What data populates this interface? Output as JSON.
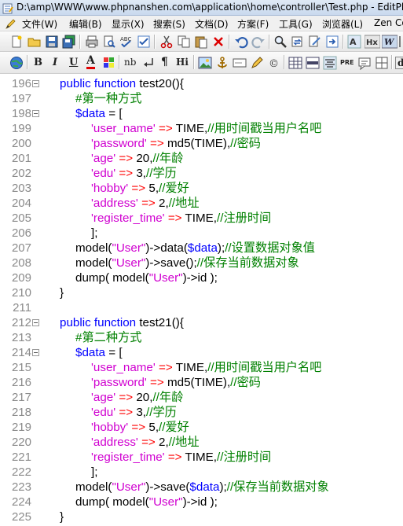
{
  "window": {
    "title": "D:\\amp\\WWW\\www.phpnanshen.com\\application\\home\\controller\\Test.php - EditPlus"
  },
  "menu": {
    "items": [
      "文件(W)",
      "编辑(B)",
      "显示(X)",
      "搜索(S)",
      "文档(D)",
      "方案(F)",
      "工具(G)",
      "浏览器(L)",
      "Zen Co"
    ]
  },
  "toolbar2": {
    "bold": "B",
    "italic": "I",
    "underline": "U",
    "font_color": "A",
    "nb": "nb",
    "para": "¶",
    "hi": "Hi",
    "pre": "PRE",
    "hx": "Hx",
    "w": "W",
    "d": "d"
  },
  "editor": {
    "lines": [
      {
        "n": "196",
        "fold": true,
        "indent": 0,
        "tokens": [
          [
            "kw",
            "public function "
          ],
          [
            "fn",
            "test20(){"
          ]
        ]
      },
      {
        "n": "197",
        "fold": false,
        "indent": 1,
        "tokens": [
          [
            "cm",
            "#第一种方式"
          ]
        ]
      },
      {
        "n": "198",
        "fold": true,
        "indent": 1,
        "tokens": [
          [
            "var",
            "$data"
          ],
          [
            "fn",
            " = ["
          ]
        ]
      },
      {
        "n": "199",
        "fold": false,
        "indent": 2,
        "tokens": [
          [
            "str",
            "'user_name'"
          ],
          [
            "op",
            " => "
          ],
          [
            "fn",
            "TIME,"
          ],
          [
            "cm",
            "//用时间戳当用户名吧"
          ]
        ]
      },
      {
        "n": "200",
        "fold": false,
        "indent": 2,
        "tokens": [
          [
            "str",
            "'password'"
          ],
          [
            "op",
            " => "
          ],
          [
            "fn",
            "md5(TIME),"
          ],
          [
            "cm",
            "//密码"
          ]
        ]
      },
      {
        "n": "201",
        "fold": false,
        "indent": 2,
        "tokens": [
          [
            "str",
            "'age'"
          ],
          [
            "op",
            " => "
          ],
          [
            "fn",
            "20,"
          ],
          [
            "cm",
            "//年龄"
          ]
        ]
      },
      {
        "n": "202",
        "fold": false,
        "indent": 2,
        "tokens": [
          [
            "str",
            "'edu'"
          ],
          [
            "op",
            " => "
          ],
          [
            "fn",
            "3,"
          ],
          [
            "cm",
            "//学历"
          ]
        ]
      },
      {
        "n": "203",
        "fold": false,
        "indent": 2,
        "tokens": [
          [
            "str",
            "'hobby'"
          ],
          [
            "op",
            " => "
          ],
          [
            "fn",
            "5,"
          ],
          [
            "cm",
            "//爱好"
          ]
        ]
      },
      {
        "n": "204",
        "fold": false,
        "indent": 2,
        "tokens": [
          [
            "str",
            "'address'"
          ],
          [
            "op",
            " => "
          ],
          [
            "fn",
            "2,"
          ],
          [
            "cm",
            "//地址"
          ]
        ]
      },
      {
        "n": "205",
        "fold": false,
        "indent": 2,
        "tokens": [
          [
            "str",
            "'register_time'"
          ],
          [
            "op",
            " => "
          ],
          [
            "fn",
            "TIME,"
          ],
          [
            "cm",
            "//注册时间"
          ]
        ]
      },
      {
        "n": "206",
        "fold": false,
        "indent": 2,
        "tokens": [
          [
            "fn",
            "];"
          ]
        ]
      },
      {
        "n": "207",
        "fold": false,
        "indent": 1,
        "tokens": [
          [
            "fn",
            "model("
          ],
          [
            "str",
            "\"User\""
          ],
          [
            "fn",
            ")->data("
          ],
          [
            "var",
            "$data"
          ],
          [
            "fn",
            ");"
          ],
          [
            "cm",
            "//设置数据对象值"
          ]
        ]
      },
      {
        "n": "208",
        "fold": false,
        "indent": 1,
        "tokens": [
          [
            "fn",
            "model("
          ],
          [
            "str",
            "\"User\""
          ],
          [
            "fn",
            ")->save();"
          ],
          [
            "cm",
            "//保存当前数据对象"
          ]
        ]
      },
      {
        "n": "209",
        "fold": false,
        "indent": 1,
        "tokens": [
          [
            "fn",
            "dump( model("
          ],
          [
            "str",
            "\"User\""
          ],
          [
            "fn",
            ")->id );"
          ]
        ]
      },
      {
        "n": "210",
        "fold": false,
        "indent": 0,
        "tokens": [
          [
            "fn",
            "}"
          ]
        ]
      },
      {
        "n": "211",
        "fold": false,
        "indent": 0,
        "tokens": []
      },
      {
        "n": "212",
        "fold": true,
        "indent": 0,
        "tokens": [
          [
            "kw",
            "public function "
          ],
          [
            "fn",
            "test21(){"
          ]
        ]
      },
      {
        "n": "213",
        "fold": false,
        "indent": 1,
        "tokens": [
          [
            "cm",
            "#第二种方式"
          ]
        ]
      },
      {
        "n": "214",
        "fold": true,
        "indent": 1,
        "tokens": [
          [
            "var",
            "$data"
          ],
          [
            "fn",
            " = ["
          ]
        ]
      },
      {
        "n": "215",
        "fold": false,
        "indent": 2,
        "tokens": [
          [
            "str",
            "'user_name'"
          ],
          [
            "op",
            " => "
          ],
          [
            "fn",
            "TIME,"
          ],
          [
            "cm",
            "//用时间戳当用户名吧"
          ]
        ]
      },
      {
        "n": "216",
        "fold": false,
        "indent": 2,
        "tokens": [
          [
            "str",
            "'password'"
          ],
          [
            "op",
            " => "
          ],
          [
            "fn",
            "md5(TIME),"
          ],
          [
            "cm",
            "//密码"
          ]
        ]
      },
      {
        "n": "217",
        "fold": false,
        "indent": 2,
        "tokens": [
          [
            "str",
            "'age'"
          ],
          [
            "op",
            " => "
          ],
          [
            "fn",
            "20,"
          ],
          [
            "cm",
            "//年龄"
          ]
        ]
      },
      {
        "n": "218",
        "fold": false,
        "indent": 2,
        "tokens": [
          [
            "str",
            "'edu'"
          ],
          [
            "op",
            " => "
          ],
          [
            "fn",
            "3,"
          ],
          [
            "cm",
            "//学历"
          ]
        ]
      },
      {
        "n": "219",
        "fold": false,
        "indent": 2,
        "tokens": [
          [
            "str",
            "'hobby'"
          ],
          [
            "op",
            " => "
          ],
          [
            "fn",
            "5,"
          ],
          [
            "cm",
            "//爱好"
          ]
        ]
      },
      {
        "n": "220",
        "fold": false,
        "indent": 2,
        "tokens": [
          [
            "str",
            "'address'"
          ],
          [
            "op",
            " => "
          ],
          [
            "fn",
            "2,"
          ],
          [
            "cm",
            "//地址"
          ]
        ]
      },
      {
        "n": "221",
        "fold": false,
        "indent": 2,
        "tokens": [
          [
            "str",
            "'register_time'"
          ],
          [
            "op",
            " => "
          ],
          [
            "fn",
            "TIME,"
          ],
          [
            "cm",
            "//注册时间"
          ]
        ]
      },
      {
        "n": "222",
        "fold": false,
        "indent": 2,
        "tokens": [
          [
            "fn",
            "];"
          ]
        ]
      },
      {
        "n": "223",
        "fold": false,
        "indent": 1,
        "tokens": [
          [
            "fn",
            "model("
          ],
          [
            "str",
            "\"User\""
          ],
          [
            "fn",
            ")->save("
          ],
          [
            "var",
            "$data"
          ],
          [
            "fn",
            ");"
          ],
          [
            "cm",
            "//保存当前数据对象"
          ]
        ]
      },
      {
        "n": "224",
        "fold": false,
        "indent": 1,
        "tokens": [
          [
            "fn",
            "dump( model("
          ],
          [
            "str",
            "\"User\""
          ],
          [
            "fn",
            ")->id );"
          ]
        ]
      },
      {
        "n": "225",
        "fold": false,
        "indent": 0,
        "tokens": [
          [
            "fn",
            "}"
          ]
        ]
      }
    ]
  },
  "colors": {
    "keyword": "#0000ff",
    "variable": "#0000ff",
    "string": "#d000d0",
    "operator": "#ff0000",
    "comment": "#008000",
    "line_number": "#8a8a8a"
  }
}
